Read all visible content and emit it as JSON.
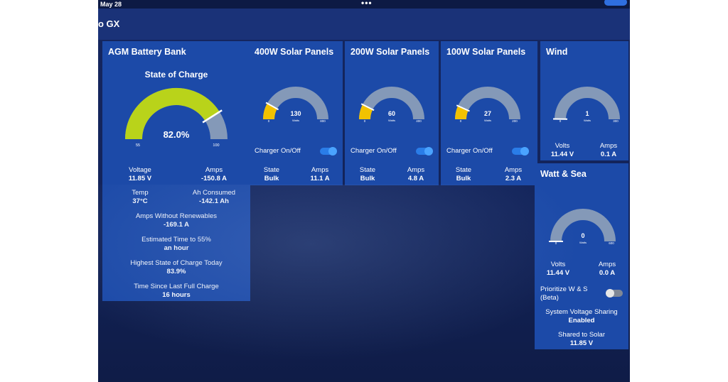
{
  "status_bar": {
    "date": "May 28",
    "dots": "•••"
  },
  "header": {
    "title": "o GX"
  },
  "battery": {
    "title": "AGM Battery Bank",
    "gauge_title": "State of Charge",
    "soc_text": "82.0%",
    "soc_fraction": 0.82,
    "scale_min": "55",
    "scale_max": "100",
    "voltage_label": "Voltage",
    "voltage_value": "11.85 V",
    "amps_label": "Amps",
    "amps_value": "-150.8 A",
    "temp_label": "Temp",
    "temp_value": "37°C",
    "ah_label": "Ah Consumed",
    "ah_value": "-142.1 Ah",
    "amps_wo_label": "Amps Without Renewables",
    "amps_wo_value": "-169.1 A",
    "ett_label": "Estimated Time to 55%",
    "ett_value": "an hour",
    "hsoc_label": "Highest State of Charge Today",
    "hsoc_value": "83.9%",
    "tslfc_label": "Time Since Last Full Charge",
    "tslfc_value": "16 hours"
  },
  "solar_400": {
    "title": "400W Solar Panels",
    "watts": "130",
    "unit": "Watts",
    "scale_min": "0",
    "scale_max": "800",
    "fraction": 0.1625,
    "charger_label": "Charger On/Off",
    "state_label": "State",
    "state_value": "Bulk",
    "amps_label": "Amps",
    "amps_value": "11.1 A"
  },
  "solar_200": {
    "title": "200W Solar Panels",
    "watts": "60",
    "unit": "Watts",
    "scale_min": "0",
    "scale_max": "400",
    "fraction": 0.15,
    "charger_label": "Charger On/Off",
    "state_label": "State",
    "state_value": "Bulk",
    "amps_label": "Amps",
    "amps_value": "4.8 A"
  },
  "solar_100": {
    "title": "100W Solar Panels",
    "watts": "27",
    "unit": "Watts",
    "scale_min": "0",
    "scale_max": "200",
    "fraction": 0.135,
    "charger_label": "Charger On/Off",
    "state_label": "State",
    "state_value": "Bulk",
    "amps_label": "Amps",
    "amps_value": "2.3 A"
  },
  "wind": {
    "title": "Wind",
    "watts": "1",
    "unit": "Watts",
    "scale_min": "0",
    "scale_max": "300",
    "fraction": 0.0033,
    "volts_label": "Volts",
    "volts_value": "11.44 V",
    "amps_label": "Amps",
    "amps_value": "0.1 A"
  },
  "watt_sea": {
    "title": "Watt & Sea",
    "watts": "0",
    "unit": "Watts",
    "scale_min": "0",
    "scale_max": "600",
    "fraction": 0,
    "volts_label": "Volts",
    "volts_value": "11.44 V",
    "amps_label": "Amps",
    "amps_value": "0.0 A",
    "prioritize_label_1": "Prioritize W & S",
    "prioritize_label_2": "(Beta)",
    "svs_label": "System Voltage Sharing",
    "svs_value": "Enabled",
    "shared_label": "Shared to Solar",
    "shared_value": "11.85 V"
  },
  "colors": {
    "panel": "#1c4aa8",
    "gauge_track": "#8499b8",
    "soc_fill": "#b9d31a",
    "solar_fill": "#f2c200",
    "toggle_on": "#2a7de8"
  }
}
